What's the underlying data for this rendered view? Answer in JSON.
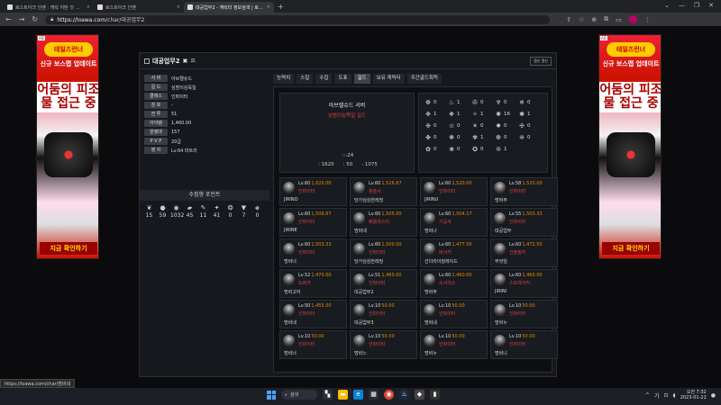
{
  "browser": {
    "tabs": [
      {
        "title": "로스트아크 인벤 : 캐릭 어떤 것 한 것 |",
        "active": false
      },
      {
        "title": "로스트아크 인벤",
        "active": false
      },
      {
        "title": "대공업무2 - 캐릭터 정보검색 | 로스트",
        "active": true
      }
    ],
    "new_tab": "+",
    "url_host": "https://loawa.com",
    "url_path": "/char/대공업무2",
    "status_url": "https://loawa.com/char/멈비네"
  },
  "ads": {
    "tag": "AD",
    "logo": "테일즈런너",
    "headline": "신규 보스맵 업데이트",
    "big": "어둠의 피조물 접근 중",
    "cta": "지금 확인하기"
  },
  "character": {
    "name": "대공업무2",
    "renew_label": "갱신 갱신",
    "info": [
      {
        "label": "서 버",
        "value": "아브렐슈드"
      },
      {
        "label": "길 드",
        "value": "심범이심묵일"
      },
      {
        "label": "클래스",
        "value": "인파이터"
      },
      {
        "label": "칭 호",
        "value": "-"
      },
      {
        "label": "전 투",
        "value": "51"
      },
      {
        "label": "아이템",
        "value": "1,460.00"
      },
      {
        "label": "원정대",
        "value": "157"
      },
      {
        "label": "P V P",
        "value": "20급"
      },
      {
        "label": "영 지",
        "value": "Lv.64 미트리"
      }
    ],
    "collect_title": "수집형 포인트",
    "collect": [
      {
        "icon": "❦",
        "value": "15",
        "name": "mokoko-icon"
      },
      {
        "icon": "●",
        "value": "59",
        "name": "island-heart-icon"
      },
      {
        "icon": "◉",
        "value": "1032",
        "name": "orpheus-star-icon"
      },
      {
        "icon": "▰",
        "value": "45",
        "name": "giant-heart-icon"
      },
      {
        "icon": "✎",
        "value": "11",
        "name": "art-icon"
      },
      {
        "icon": "✦",
        "value": "41",
        "name": "voyage-icon"
      },
      {
        "icon": "❂",
        "value": "0",
        "name": "world-tree-leaf-icon"
      },
      {
        "icon": "▼",
        "value": "7",
        "name": "ignea-icon"
      },
      {
        "icon": "◈",
        "value": "0",
        "name": "memory-icon"
      }
    ]
  },
  "tabs": [
    {
      "label": "능력치",
      "active": false
    },
    {
      "label": "스킬",
      "active": false
    },
    {
      "label": "수집",
      "active": false
    },
    {
      "label": "도표",
      "active": false
    },
    {
      "label": "길드",
      "active": true
    },
    {
      "label": "보유 캐릭터",
      "active": false
    },
    {
      "label": "주간골드획득",
      "active": false
    }
  ],
  "guild": {
    "server": "아브렐슈드 서버",
    "name": "심범이심묵일 길드",
    "members": ":::24",
    "stats": [
      ": 1620",
      ": 50",
      ": 1075"
    ]
  },
  "engravings": [
    {
      "icon": "☸",
      "value": "0"
    },
    {
      "icon": "♨",
      "value": "1"
    },
    {
      "icon": "✇",
      "value": "0"
    },
    {
      "icon": "♆",
      "value": "0"
    },
    {
      "icon": "✵",
      "value": "0"
    },
    {
      "icon": "✥",
      "value": "1"
    },
    {
      "icon": "❖",
      "value": "1"
    },
    {
      "icon": "✧",
      "value": "1"
    },
    {
      "icon": "✺",
      "value": "16"
    },
    {
      "icon": "✱",
      "value": "1"
    },
    {
      "icon": "❉",
      "value": "0"
    },
    {
      "icon": "✫",
      "value": "0"
    },
    {
      "icon": "✶",
      "value": "0"
    },
    {
      "icon": "✹",
      "value": "0"
    },
    {
      "icon": "✣",
      "value": "0"
    },
    {
      "icon": "✤",
      "value": "0"
    },
    {
      "icon": "❃",
      "value": "0"
    },
    {
      "icon": "✾",
      "value": "1"
    },
    {
      "icon": "❁",
      "value": "0"
    },
    {
      "icon": "❈",
      "value": "0"
    },
    {
      "icon": "✿",
      "value": "0"
    },
    {
      "icon": "❀",
      "value": "0"
    },
    {
      "icon": "✪",
      "value": "0"
    },
    {
      "icon": "❊",
      "value": "1"
    }
  ],
  "members": [
    {
      "lv": "Lv.60",
      "il": "1,620.00",
      "cls": "인파이터",
      "name": "JIRINO"
    },
    {
      "lv": "Lv.60",
      "il": "1,526.67",
      "cls": "창술사",
      "name": "당가심심한레밍"
    },
    {
      "lv": "Lv.60",
      "il": "1,520.00",
      "cls": "인파이터",
      "name": "JIRINU"
    },
    {
      "lv": "Lv.58",
      "il": "1,520.00",
      "cls": "인파이터",
      "name": "멍비주"
    },
    {
      "lv": "Lv.60",
      "il": "1,506.67",
      "cls": "인파이터",
      "name": "JIRINE"
    },
    {
      "lv": "Lv.60",
      "il": "1,505.00",
      "cls": "배틀마스터",
      "name": "멍비네"
    },
    {
      "lv": "Lv.60",
      "il": "1,504.17",
      "cls": "기공사",
      "name": "멍비나"
    },
    {
      "lv": "Lv.55",
      "il": "1,503.33",
      "cls": "인파이터",
      "name": "대공업무"
    },
    {
      "lv": "Lv.60",
      "il": "1,503.33",
      "cls": "인파이터",
      "name": "멍비너"
    },
    {
      "lv": "Lv.60",
      "il": "1,500.00",
      "cls": "인파이터",
      "name": "당가심심한레밍"
    },
    {
      "lv": "Lv.60",
      "il": "1,477.50",
      "cls": "버서커",
      "name": "선더라이징레이드"
    },
    {
      "lv": "Lv.60",
      "il": "1,472.50",
      "cls": "건슬링어",
      "name": "무엇임"
    },
    {
      "lv": "Lv.52",
      "il": "1,470.00",
      "cls": "도화가",
      "name": "멍비고어"
    },
    {
      "lv": "Lv.51",
      "il": "1,460.00",
      "cls": "인파이터",
      "name": "대공업무2"
    },
    {
      "lv": "Lv.60",
      "il": "1,460.00",
      "cls": "소서리스",
      "name": "멍비주"
    },
    {
      "lv": "Lv.60",
      "il": "1,460.00",
      "cls": "스트라이커",
      "name": "JIRINI"
    },
    {
      "lv": "Lv.50",
      "il": "1,455.00",
      "cls": "인파이터",
      "name": "멍비네"
    },
    {
      "lv": "Lv.10",
      "il": "50.00",
      "cls": "인파이터",
      "name": "대공업무3"
    },
    {
      "lv": "Lv.10",
      "il": "50.00",
      "cls": "인파이터",
      "name": "멍비내"
    },
    {
      "lv": "Lv.10",
      "il": "50.00",
      "cls": "인파이터",
      "name": "멍비누"
    },
    {
      "lv": "Lv.10",
      "il": "50.00",
      "cls": "인파이터",
      "name": "멍비너"
    },
    {
      "lv": "Lv.10",
      "il": "50.00",
      "cls": "인파이터",
      "name": "멍비느"
    },
    {
      "lv": "Lv.10",
      "il": "50.00",
      "cls": "인파이터",
      "name": "멍비누"
    },
    {
      "lv": "Lv.10",
      "il": "50.00",
      "cls": "인파이터",
      "name": "멍비니"
    }
  ],
  "taskbar": {
    "search_label": "검색",
    "tray_lang": "가",
    "time": "오전 7:32",
    "date": "2023-01-22"
  }
}
